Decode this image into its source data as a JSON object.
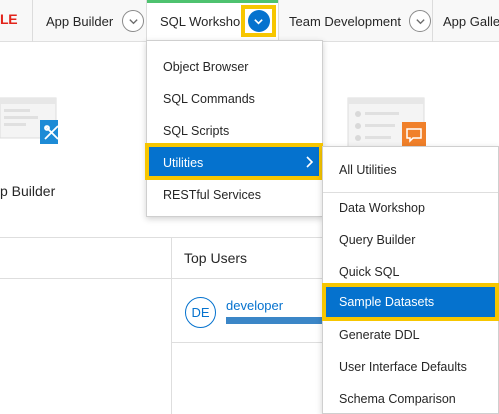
{
  "nav": {
    "logo_fragment": "LE",
    "tabs": [
      {
        "label": "App Builder"
      },
      {
        "label": "SQL Workshop"
      },
      {
        "label": "Team Development"
      },
      {
        "label": "App Gallery"
      }
    ]
  },
  "background": {
    "app_builder_caption": "p Builder",
    "top_users": {
      "title": "Top Users",
      "user": {
        "initials": "DE",
        "name": "developer",
        "activity_fraction": 1.0
      }
    }
  },
  "sql_workshop_menu": {
    "items": [
      {
        "label": "Object Browser"
      },
      {
        "label": "SQL Commands"
      },
      {
        "label": "SQL Scripts"
      },
      {
        "label": "Utilities",
        "selected": true
      },
      {
        "label": "RESTful Services"
      }
    ]
  },
  "utilities_menu": {
    "items": [
      {
        "label": "All Utilities"
      },
      {
        "label": "Data Workshop"
      },
      {
        "label": "Query Builder"
      },
      {
        "label": "Quick SQL"
      },
      {
        "label": "Sample Datasets",
        "selected": true
      },
      {
        "label": "Generate DDL"
      },
      {
        "label": "User Interface Defaults"
      },
      {
        "label": "Schema Comparison"
      }
    ]
  },
  "colors": {
    "accent_blue": "#0572ce",
    "highlight_yellow": "#f7c600",
    "active_tab_green": "#4ec26f",
    "logo_red": "#e2231a"
  },
  "icons": [
    "chevron-down-icon",
    "chevron-right-icon",
    "app-builder-illustration",
    "team-development-illustration"
  ]
}
